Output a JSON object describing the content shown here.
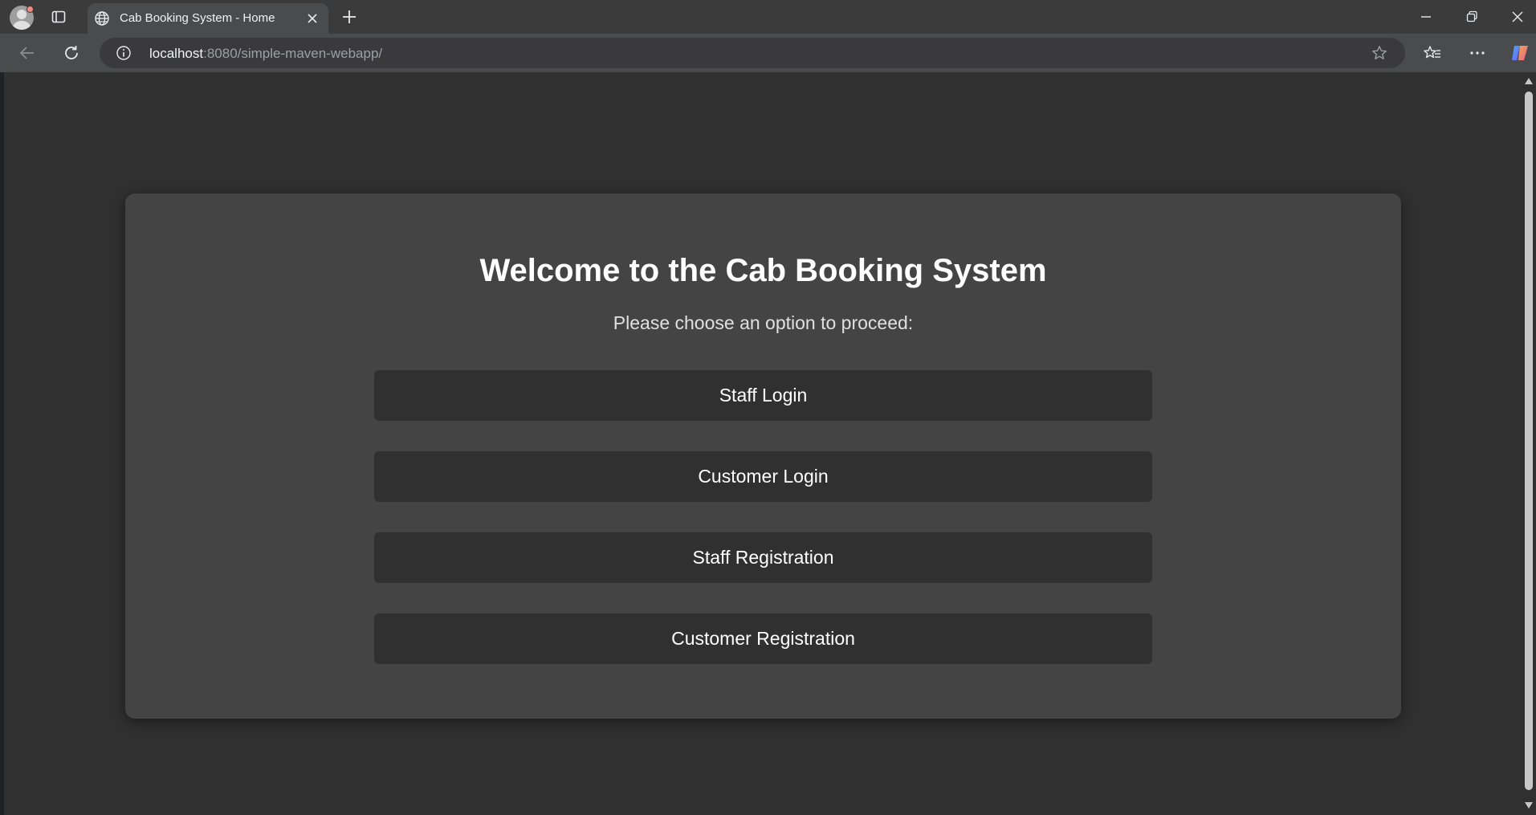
{
  "browser": {
    "tab": {
      "title": "Cab Booking System - Home"
    },
    "address_bar": {
      "host": "localhost",
      "path": ":8080/simple-maven-webapp/"
    }
  },
  "page": {
    "heading": "Welcome to the Cab Booking System",
    "subtitle": "Please choose an option to proceed:",
    "options": [
      {
        "label": "Staff Login"
      },
      {
        "label": "Customer Login"
      },
      {
        "label": "Staff Registration"
      },
      {
        "label": "Customer Registration"
      }
    ]
  },
  "colors": {
    "page_background": "#303030",
    "card_background": "#444444",
    "button_background": "#303030",
    "text": "#ffffff"
  }
}
